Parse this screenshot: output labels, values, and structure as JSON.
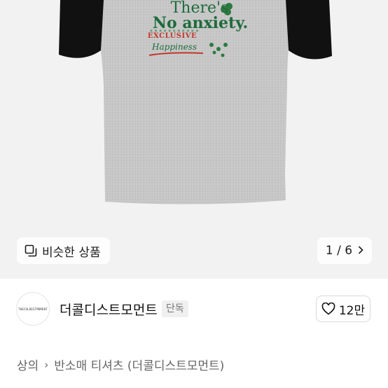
{
  "product_image": {
    "print": {
      "line1": "There's",
      "line2": "No anxiety.",
      "line3": "EXCLUSIVE",
      "line4": "Happiness"
    },
    "similar_button": {
      "label": "비슷한 상품",
      "icon": "similar-items-icon"
    },
    "counter": {
      "text": "1 / 6",
      "icon": "chevron-right-icon"
    }
  },
  "seller": {
    "avatar_text": "THECOLDESTMOMENT",
    "name": "더콜디스트모먼트",
    "badge": "단독",
    "likes": "12만",
    "like_icon": "heart-icon"
  },
  "breadcrumb": {
    "items": [
      "상의",
      "반소매 티셔츠 (더콜디스트모먼트)"
    ],
    "separator": "›"
  },
  "colors": {
    "print_green": "#1f6b3c",
    "print_red": "#c0392b",
    "shirt_body": "#c9c9c9",
    "sleeve": "#111111"
  }
}
